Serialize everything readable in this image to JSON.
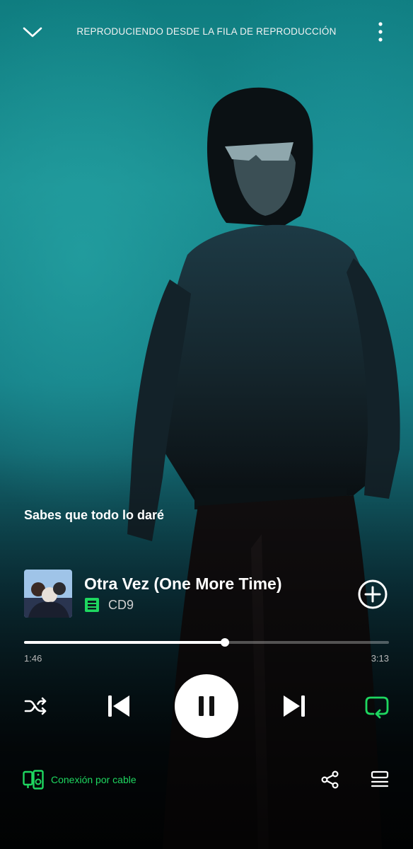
{
  "header": {
    "context_label": "REPRODUCIENDO DESDE LA FILA DE REPRODUCCIÓN",
    "collapse_icon": "chevron-down-icon",
    "more_icon": "more-vertical-icon"
  },
  "lyrics": {
    "current_line": "Sabes que todo lo daré"
  },
  "track": {
    "title": "Otra Vez (One More Time)",
    "artist": "CD9",
    "artist_badge_icon": "downloaded-icon",
    "add_icon": "add-circle-icon"
  },
  "progress": {
    "elapsed": "1:46",
    "duration": "3:13",
    "fraction": 0.55
  },
  "controls": {
    "shuffle_icon": "shuffle-icon",
    "previous_icon": "skip-previous-icon",
    "play_pause_icon": "pause-icon",
    "next_icon": "skip-next-icon",
    "repeat_icon": "repeat-icon",
    "repeat_active": true
  },
  "footer": {
    "device_label": "Conexión por cable",
    "device_icon": "connected-device-icon",
    "share_icon": "share-icon",
    "queue_icon": "queue-icon"
  },
  "colors": {
    "accent": "#1ed760",
    "background_top": "#0f7d80",
    "background_bottom": "#05090b",
    "text_primary": "#ffffff",
    "text_secondary": "#b8b8b8"
  }
}
